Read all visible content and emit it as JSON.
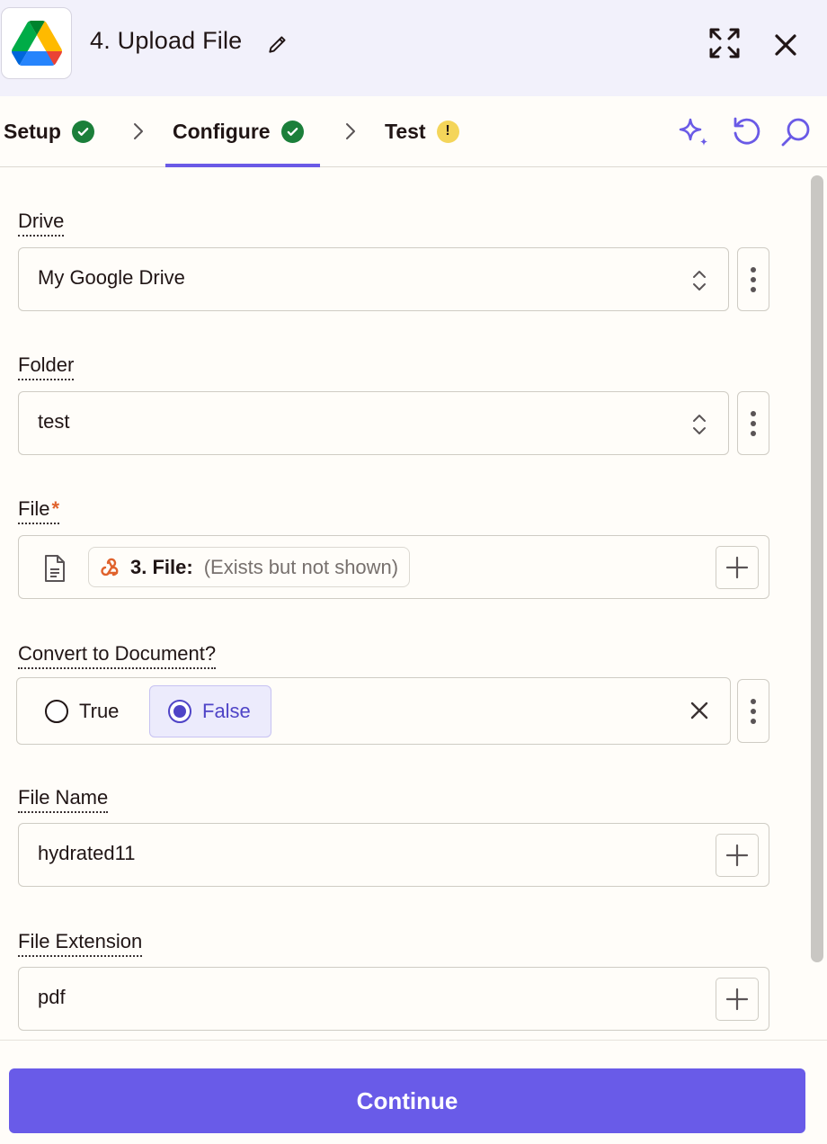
{
  "header": {
    "title": "4. Upload File",
    "icons": {
      "app": "google-drive-logo",
      "edit": "pencil-icon",
      "expand": "expand-icon",
      "close": "close-icon"
    }
  },
  "tabs": [
    {
      "label": "Setup",
      "status": "complete"
    },
    {
      "label": "Configure",
      "status": "complete",
      "active": true
    },
    {
      "label": "Test",
      "status": "warning",
      "badge": "!"
    }
  ],
  "toolbar_icons": [
    "sparkle-icon",
    "undo-icon",
    "search-icon"
  ],
  "fields": {
    "drive": {
      "label": "Drive",
      "value": "My Google Drive"
    },
    "folder": {
      "label": "Folder",
      "value": "test"
    },
    "file": {
      "label": "File",
      "required_mark": "*",
      "pill_step": "3. File:",
      "pill_value": "(Exists but not shown)"
    },
    "convert": {
      "label": "Convert to Document?",
      "option_true": "True",
      "option_false": "False",
      "selected": "False"
    },
    "file_name": {
      "label": "File Name",
      "value": "hydrated11"
    },
    "file_extension": {
      "label": "File Extension",
      "value": "pdf"
    }
  },
  "footer": {
    "continue_label": "Continue"
  },
  "colors": {
    "accent": "#695be8",
    "success": "#1b7f3a",
    "warning": "#f4d55a",
    "required": "#e0622c",
    "header_bg": "#f2f1fb"
  }
}
